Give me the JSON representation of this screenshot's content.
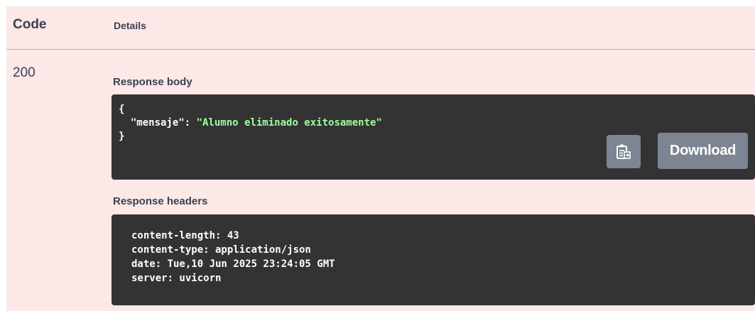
{
  "table": {
    "code_header": "Code",
    "details_header": "Details"
  },
  "response": {
    "status_code": "200",
    "body_label": "Response body",
    "body": {
      "open_brace": "{",
      "key": "\"mensaje\"",
      "colon": ": ",
      "value": "\"Alumno eliminado exitosamente\"",
      "close_brace": "}"
    },
    "copy_icon": "clipboard-copy-icon",
    "download_label": "Download",
    "headers_label": "Response headers",
    "headers": [
      "content-length: 43",
      "content-type: application/json",
      "date: Tue,10 Jun 2025 23:24:05 GMT",
      "server: uvicorn"
    ]
  },
  "colors": {
    "panel_bg": "#fde8e8",
    "code_bg": "#333333",
    "json_string": "#a2fca2",
    "button_bg": "#7d8492",
    "text": "#3b4151"
  }
}
